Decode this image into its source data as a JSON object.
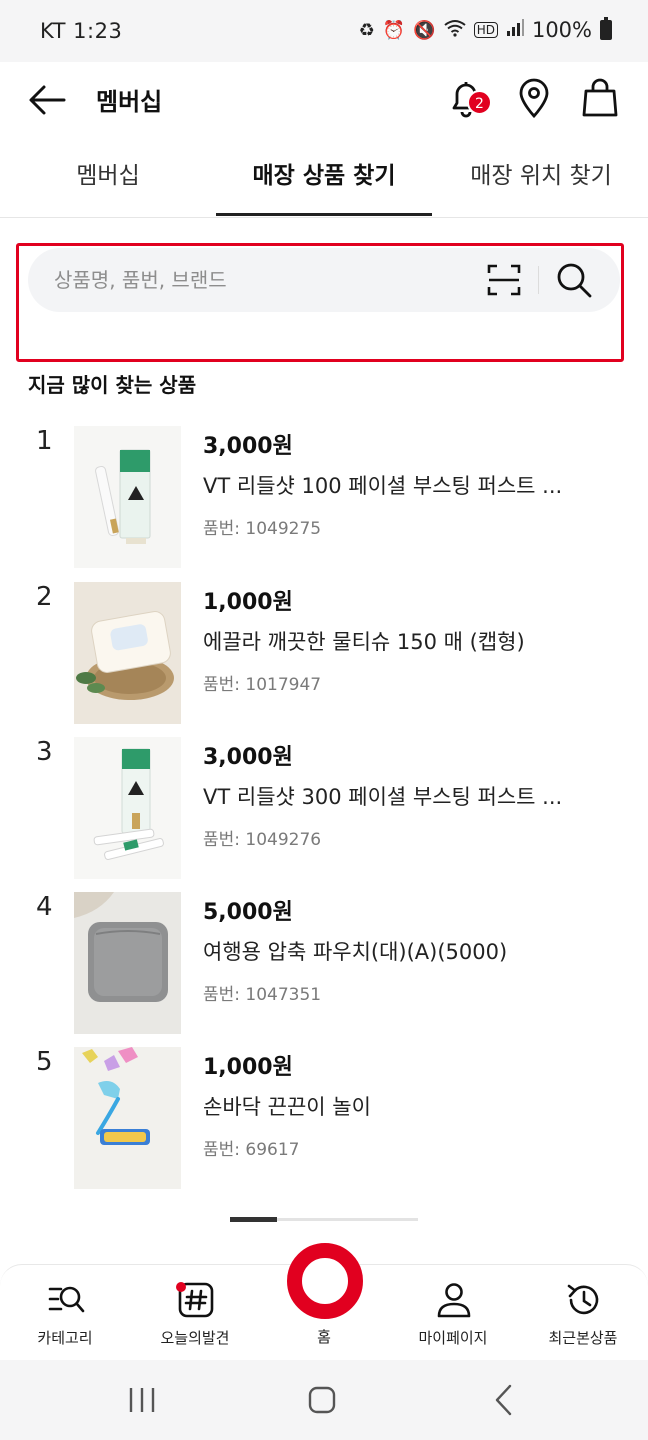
{
  "status_bar": {
    "time": "KT 1:23",
    "battery": "100%",
    "icons": [
      "recycle-icon",
      "alarm-icon",
      "mute-icon",
      "wifi-icon",
      "hd-icon",
      "signal-icon",
      "battery-icon"
    ]
  },
  "header": {
    "title": "멤버십",
    "notification_count": "2"
  },
  "tabs": [
    {
      "label": "멤버십",
      "active": false
    },
    {
      "label": "매장 상품 찾기",
      "active": true
    },
    {
      "label": "매장 위치 찾기",
      "active": false
    }
  ],
  "search": {
    "placeholder": "상품명, 품번, 브랜드",
    "value": ""
  },
  "section_title": "지금 많이 찾는 상품",
  "products": [
    {
      "rank": "1",
      "price": "3,000원",
      "name": "VT 리들샷 100 페이셜 부스팅 퍼스트 ...",
      "sku": "품번: 1049275"
    },
    {
      "rank": "2",
      "price": "1,000원",
      "name": "에끌라 깨끗한 물티슈 150 매 (캡형)",
      "sku": "품번: 1017947"
    },
    {
      "rank": "3",
      "price": "3,000원",
      "name": "VT 리들샷 300 페이셜 부스팅 퍼스트 ...",
      "sku": "품번: 1049276"
    },
    {
      "rank": "4",
      "price": "5,000원",
      "name": "여행용 압축 파우치(대)(A)(5000)",
      "sku": "품번: 1047351"
    },
    {
      "rank": "5",
      "price": "1,000원",
      "name": "손바닥 끈끈이 놀이",
      "sku": "품번: 69617"
    }
  ],
  "bottom_nav": {
    "category": "카테고리",
    "today": "오늘의발견",
    "home": "홈",
    "mypage": "마이페이지",
    "recent": "최근본상품"
  },
  "colors": {
    "accent": "#e1001f"
  }
}
